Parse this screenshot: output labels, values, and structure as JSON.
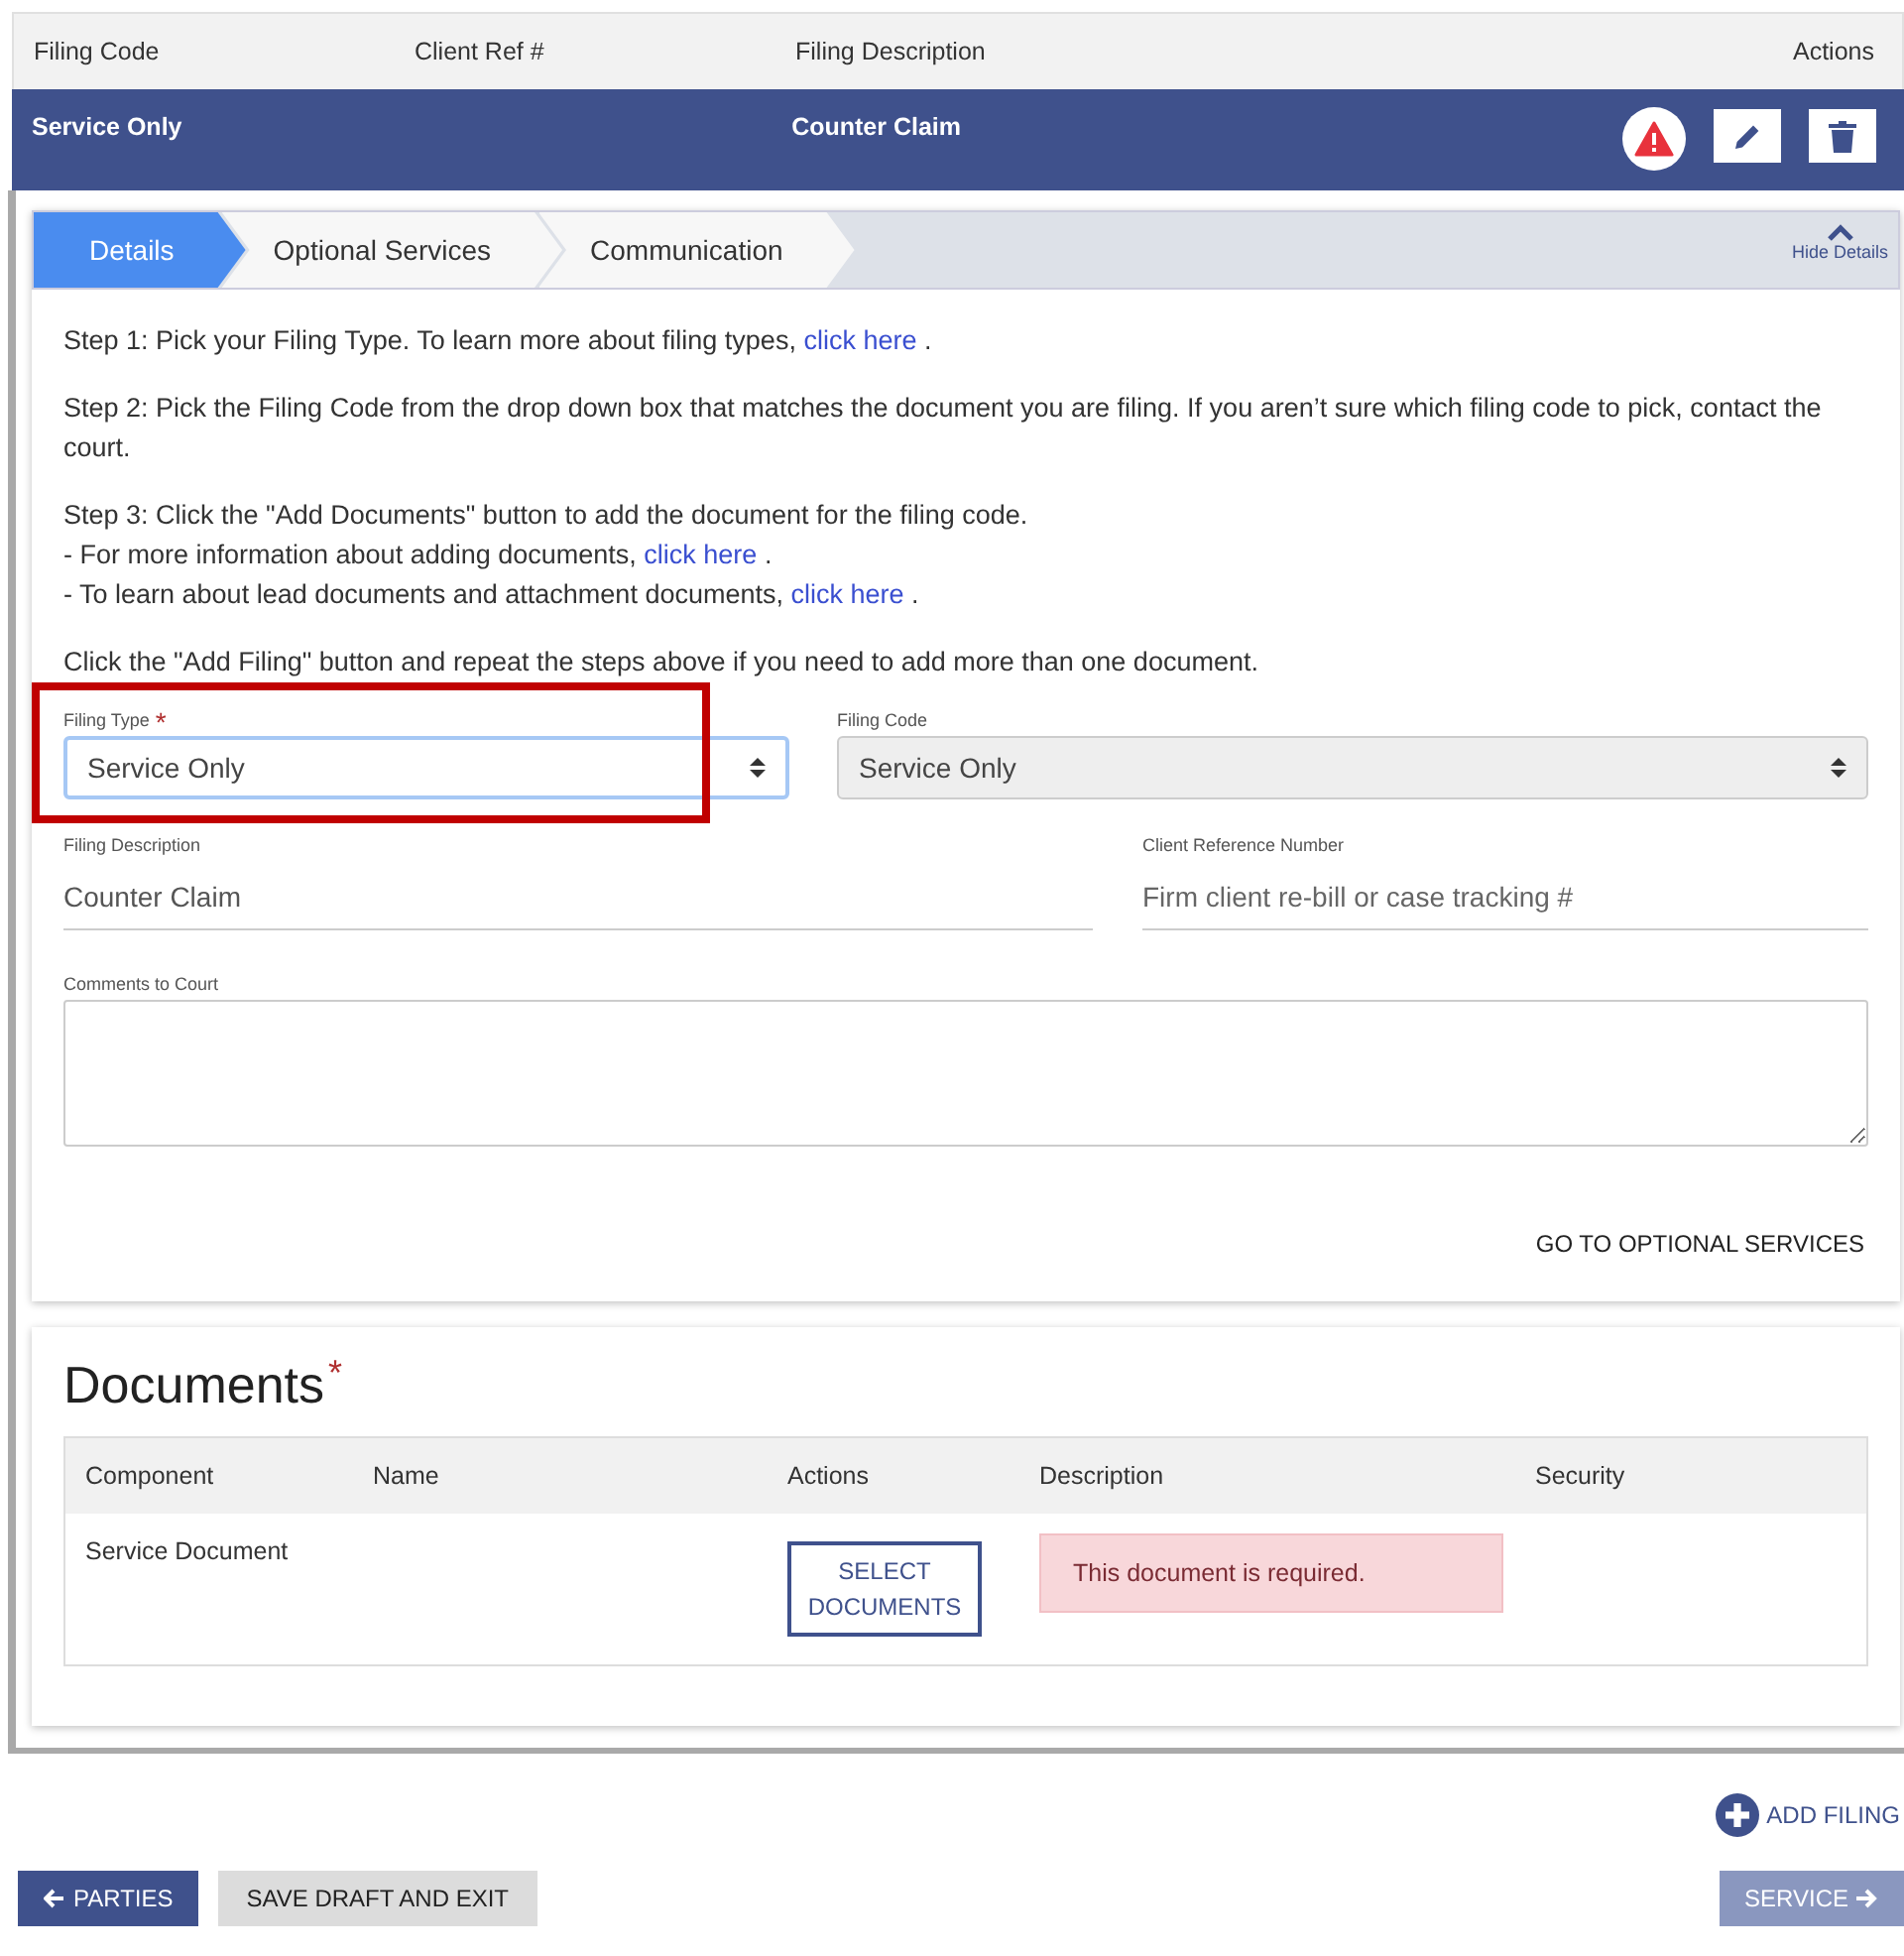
{
  "filings_table": {
    "columns": [
      "Filing Code",
      "Client Ref #",
      "Filing Description",
      "Actions"
    ],
    "rows": [
      {
        "cells": [
          "Service Only",
          "",
          "Counter Claim"
        ],
        "warning": true,
        "selected": true
      }
    ]
  },
  "tabs": [
    {
      "label": "Details",
      "selected": true
    },
    {
      "label": "Optional Services",
      "selected": false
    },
    {
      "label": "Communication",
      "selected": false
    }
  ],
  "hide_details": "Hide Details",
  "instructions": [
    {
      "lines": [
        {
          "text": "Step 1: Pick your Filing Type. To learn more about filing types, ",
          "link": "click here",
          "after": " ."
        }
      ]
    },
    {
      "lines": [
        {
          "text": "Step 2: Pick the Filing Code from the drop down box that matches the document you are filing. If you aren’t sure which filing code to pick, contact the court."
        }
      ]
    },
    {
      "lines": [
        {
          "text": "Step 3: Click the \"Add Documents\" button to add the document for the filing code."
        },
        {
          "text": "- For more information about adding documents, ",
          "link": "click here",
          "after": " ."
        },
        {
          "text": "- To learn about lead documents and attachment documents, ",
          "link": "click here",
          "after": " ."
        }
      ]
    },
    {
      "lines": [
        {
          "text": "Click the \"Add Filing\" button and repeat the steps above if you need to add more than one document."
        }
      ]
    }
  ],
  "filing_type": {
    "label": "Filing Type",
    "required_mark": "*",
    "value": "Service Only",
    "highlighted": true
  },
  "filing_code": {
    "label": "Filing Code",
    "value": "Service Only",
    "disabled": true
  },
  "filing_description": {
    "label": "Filing Description",
    "value": "Counter Claim"
  },
  "client_reference": {
    "label": "Client Reference Number",
    "placeholder": "Firm client re-bill or case tracking #"
  },
  "comments": {
    "label": "Comments to Court"
  },
  "next_link": "GO TO OPTIONAL SERVICES",
  "documents": {
    "title": "Documents",
    "required_mark": "*",
    "columns": [
      "Component",
      "Name",
      "Actions",
      "Description",
      "Security"
    ],
    "rows": [
      {
        "component": "Service Document",
        "button": "SELECT DOCUMENTS",
        "error": "This document is required."
      }
    ]
  },
  "add_filing": "ADD FILING",
  "buttons": {
    "back": "PARTIES",
    "save": "SAVE DRAFT AND EXIT",
    "next": "SERVICE",
    "next_disabled": true
  }
}
